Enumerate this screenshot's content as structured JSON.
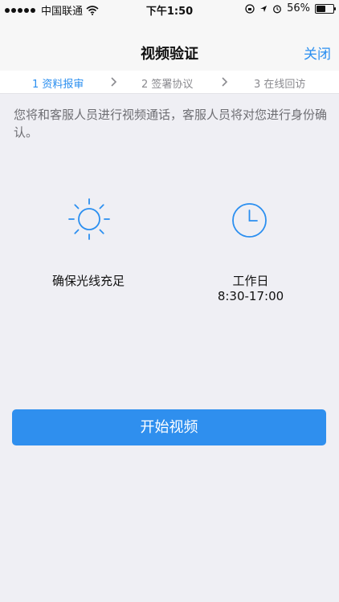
{
  "status_bar": {
    "carrier": "中国联通",
    "time": "下午1:50",
    "battery_percent_label": "56%",
    "battery_level": 0.56
  },
  "nav": {
    "title": "视频验证",
    "close_label": "关闭"
  },
  "steps": [
    {
      "label": "1 资料报审",
      "active": true
    },
    {
      "label": "2 签署协议",
      "active": false
    },
    {
      "label": "3 在线回访",
      "active": false
    }
  ],
  "intro": {
    "text": "您将和客服人员进行视频通话，客服人员将对您进行身份确认。"
  },
  "features": {
    "light": {
      "icon": "sun-icon",
      "label": "确保光线充足"
    },
    "hours": {
      "icon": "clock-icon",
      "label": "工作日",
      "time": "8:30-17:00"
    }
  },
  "start_button": {
    "label": "开始视频"
  },
  "colors": {
    "accent": "#2b8ff0",
    "button": "#2f8fee",
    "background": "#efeff4"
  }
}
